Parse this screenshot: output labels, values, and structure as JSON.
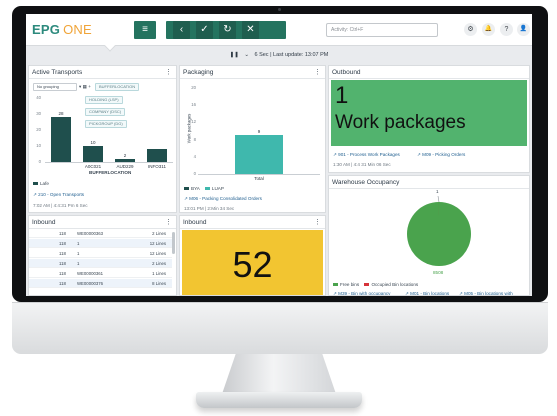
{
  "header": {
    "logo_epg": "EPG",
    "logo_one": "ONE",
    "menu_icon": "≡",
    "back_icon": "‹",
    "check_icon": "✓",
    "refresh_icon": "↻",
    "close_icon": "✕",
    "search_placeholder": "Activity: Ctrl+F",
    "settings_icon": "⚙",
    "bell_icon": "🔔",
    "help_icon": "?",
    "user_icon": "👤"
  },
  "subbar": {
    "pause_icon": "❚❚",
    "chevron_icon": "⌄",
    "text": "6 Sec | Last update: 13:07 PM"
  },
  "active_transports": {
    "title": "Active Transports",
    "filter_value": "No grouping",
    "chip_bufferlocation": "BUFFERLOCATION",
    "chip_holding": "HOLDING (LSP)",
    "chip_company": "COMPANY (DSC)",
    "chip_pickgroup": "PICKGROUP (DG)",
    "xlabel": "BUFFERLOCATION",
    "legend_label": "Lafe",
    "footer_link": "210 - Open Transports",
    "footer_time": "7:02 AM  |  4:4:31 Pm 6 Sec",
    "chart_data": {
      "type": "bar",
      "categories": [
        "",
        "A0C021",
        "AUD229",
        "INFO311"
      ],
      "values": [
        28,
        10,
        2,
        8
      ],
      "value_labels": [
        "28",
        "10",
        "2",
        ""
      ],
      "yticks": [
        "40",
        "30",
        "20",
        "10",
        "0"
      ],
      "ylim": [
        0,
        40
      ],
      "xlabel": "BUFFERLOCATION"
    }
  },
  "packaging": {
    "title": "Packaging",
    "ylabel": "Work packages",
    "legend_a": "BYA",
    "legend_b": "LUAP",
    "footer_link": "M06 - Packing Consolidated Orders",
    "footer_time": "13:01 PM  |  2:Min 34 Sec",
    "chart_data": {
      "type": "bar",
      "categories": [
        "Total"
      ],
      "values": [
        9
      ],
      "value_labels": [
        "9"
      ],
      "yticks": [
        "20",
        "16",
        "12",
        "8",
        "4",
        "0"
      ],
      "ylim": [
        0,
        20
      ],
      "ylabel": "Work packages"
    }
  },
  "outbound": {
    "title": "Outbound",
    "big_value": "1",
    "big_label": "Work packages",
    "link_a": "901 - Process Work Packages",
    "link_b": "M09 - Picking Orders",
    "footer_time": "1:30 AM  |  4:4 31 Min 06 Sec"
  },
  "warehouse": {
    "title": "Warehouse Occupancy",
    "pie_top_label": "1",
    "pie_bottom_label": "8508",
    "legend_free": "Free bins",
    "legend_occupied": "Occupied Bin locations",
    "footer_a": "M39 - Bin with occupancy",
    "footer_b": "M01 - Bin locations",
    "footer_c": "M05 - Bin locations with",
    "chart_data": {
      "type": "pie",
      "categories": [
        "Free bins",
        "Occupied Bin locations"
      ],
      "values": [
        8508,
        1
      ],
      "colors": [
        "#4aa34d",
        "#d6333a"
      ]
    }
  },
  "inbound_table": {
    "title": "Inbound",
    "rows": [
      {
        "num": "118",
        "id": "WE00000363",
        "lines": "2 Lines"
      },
      {
        "num": "118",
        "id": "1",
        "lines": "12 Lines"
      },
      {
        "num": "118",
        "id": "1",
        "lines": "12 Lines"
      },
      {
        "num": "118",
        "id": "1",
        "lines": "2 Lines"
      },
      {
        "num": "118",
        "id": "WE00000361",
        "lines": "1 Lines"
      },
      {
        "num": "118",
        "id": "WE00000376",
        "lines": "8 Lines"
      }
    ]
  },
  "inbound_kpi": {
    "title": "Inbound",
    "big_value": "52"
  },
  "colors": {
    "teal": "#2c8a7d",
    "orange": "#f0a438",
    "toolbar": "#1f5e4f",
    "dark_bar": "#1f4f4d",
    "packaging_bar": "#3fb8ad",
    "outbound_bg": "#52b36e",
    "inbound_kpi_bg": "#f2c531"
  }
}
